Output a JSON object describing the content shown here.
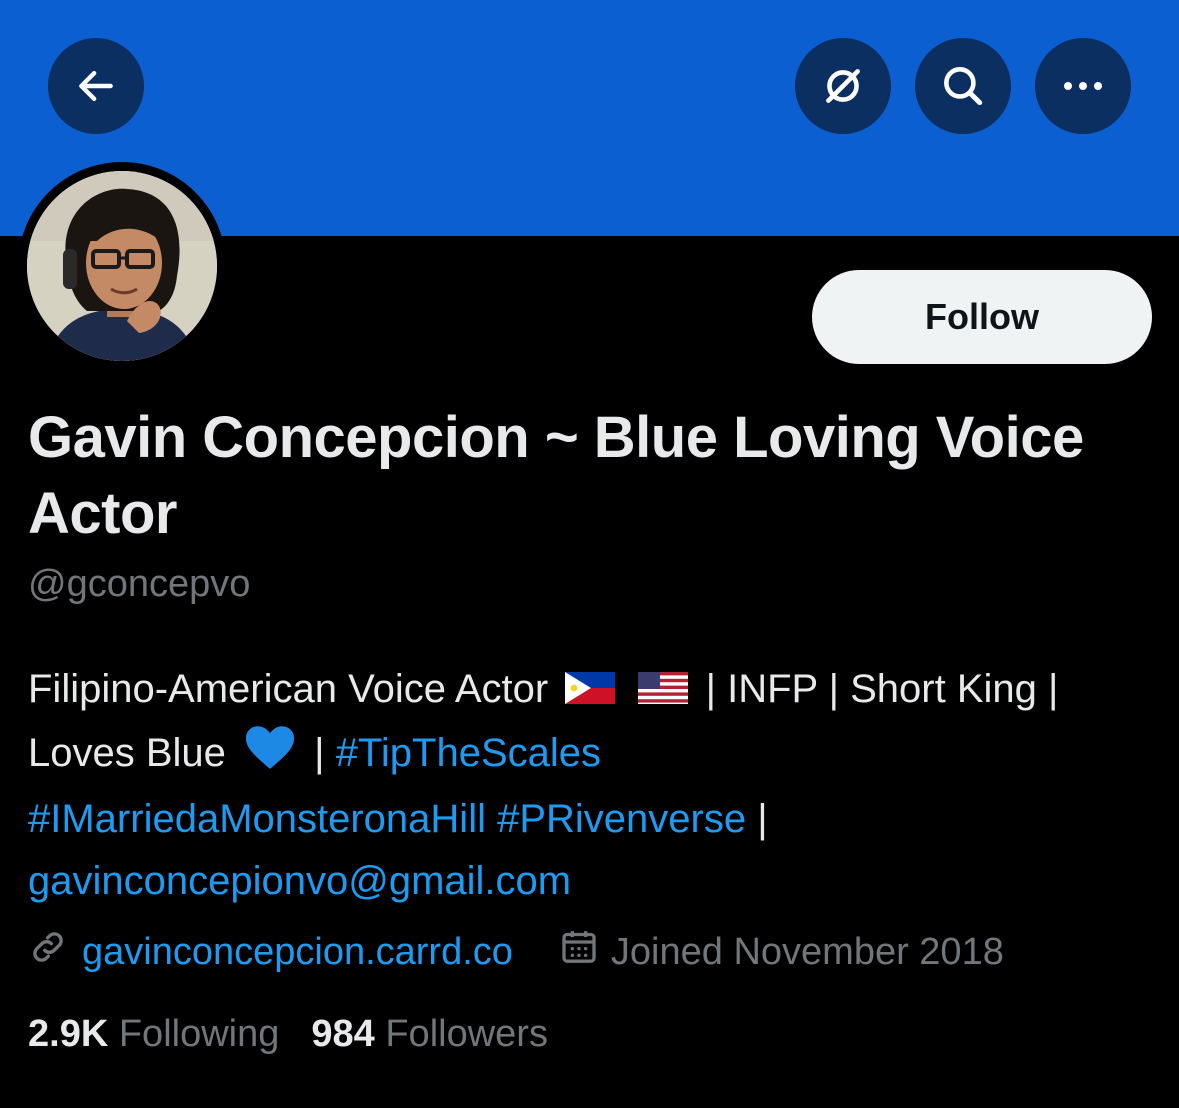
{
  "profile": {
    "display_name": "Gavin Concepcion ~ Blue Loving Voice Actor",
    "handle": "@gconcepvo",
    "follow_label": "Follow",
    "bio": {
      "text1": "Filipino-American Voice Actor",
      "flag1": "philippines-flag",
      "flag2": "us-flag",
      "text2": "| INFP | Short King |",
      "text3": "Loves Blue",
      "heart": "blue-heart-emoji",
      "sep1": "|",
      "tag1": "#TipTheScales",
      "tag2": "#IMarriedaMonsteronaHill",
      "tag3": "#PRivenverse",
      "sep2": "|",
      "email": "gavinconcepionvo@gmail.com"
    },
    "website": "gavinconcepcion.carrd.co",
    "joined": "Joined November 2018",
    "following_count": "2.9K",
    "following_label": "Following",
    "followers_count": "984",
    "followers_label": "Followers"
  },
  "header_icons": [
    "back-arrow-icon",
    "grok-icon",
    "search-icon",
    "more-icon"
  ],
  "colors": {
    "banner": "#0b5fd0",
    "link": "#1d9bf0",
    "background": "#000000",
    "muted": "#71767b"
  }
}
